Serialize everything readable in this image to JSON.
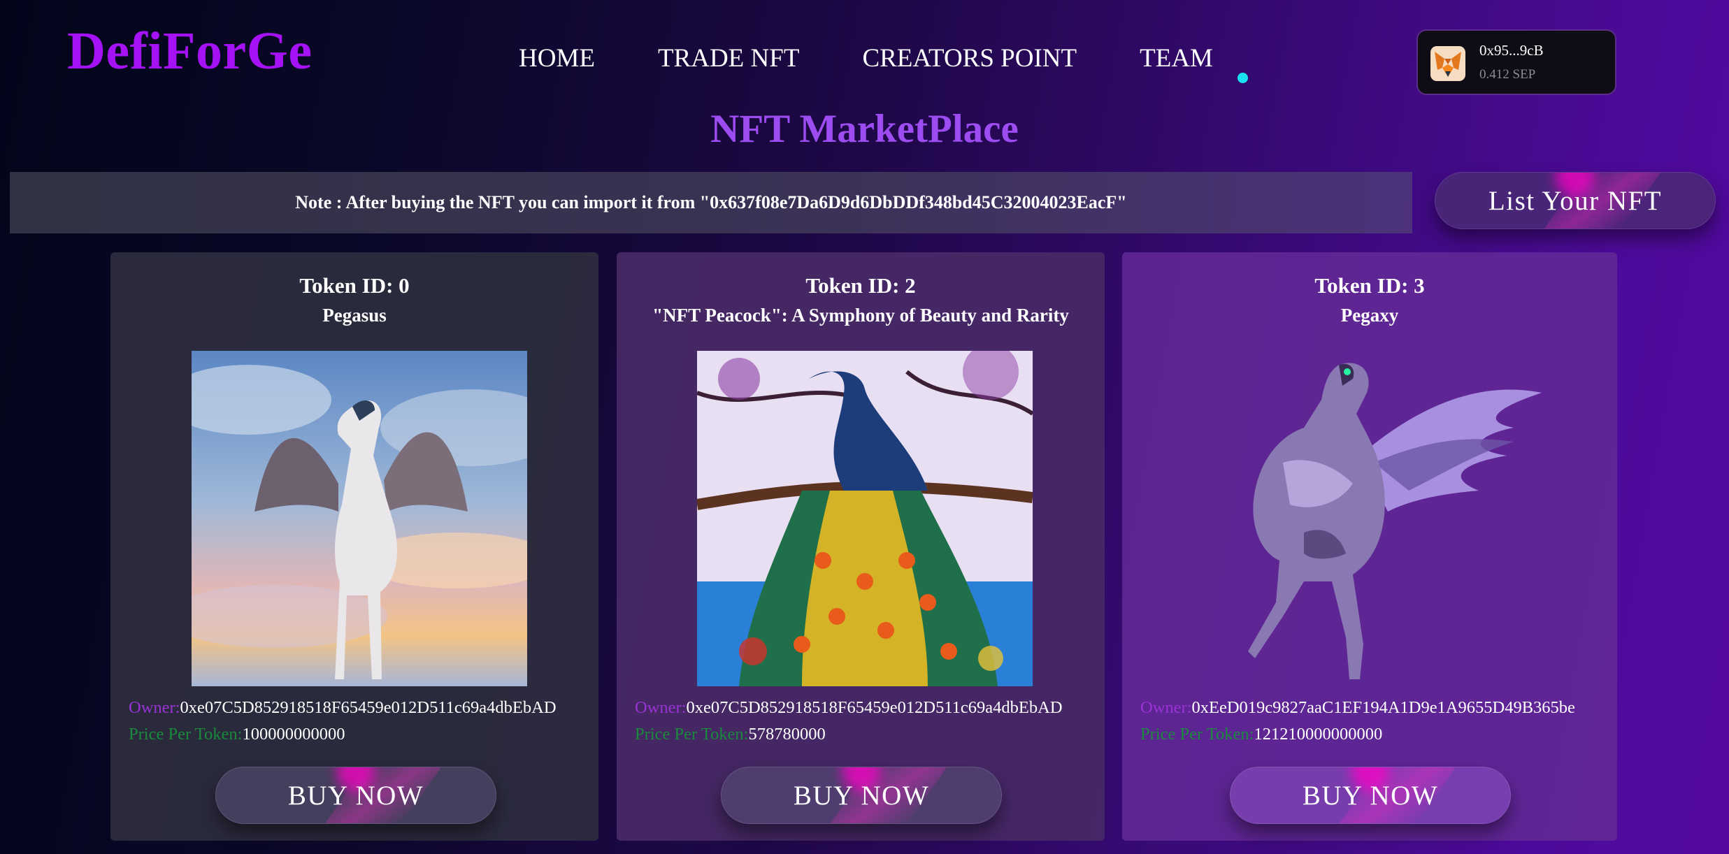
{
  "header": {
    "logo": "DefiForGe",
    "nav": [
      "HOME",
      "TRADE NFT",
      "CREATORS POINT",
      "TEAM"
    ]
  },
  "wallet": {
    "icon": "metamask-fox-icon",
    "address": "0x95...9cB",
    "balance": "0.412 SEP"
  },
  "page": {
    "title": "NFT MarketPlace",
    "note": "Note : After buying the NFT you can import it from \"0x637f08e7Da6D9d6DbDDf348bd45C32004023EacF\"",
    "list_button": "List Your NFT"
  },
  "cards": [
    {
      "token_id": "Token ID: 0",
      "name": "Pegasus",
      "image": "white-pegasus-clouds-image",
      "owner_label": "Owner:",
      "owner": "0xe07C5D852918518F65459e012D511c69a4dbEbAD",
      "price_label": "Price Per Token:",
      "price": "100000000000",
      "buy_label": "BUY NOW"
    },
    {
      "token_id": "Token ID: 2",
      "name": "\"NFT Peacock\": A Symphony of Beauty and Rarity",
      "image": "colorful-peacock-painting-image",
      "owner_label": "Owner:",
      "owner": "0xe07C5D852918518F65459e012D511c69a4dbEbAD",
      "price_label": "Price Per Token:",
      "price": "578780000",
      "buy_label": "BUY NOW"
    },
    {
      "token_id": "Token ID: 3",
      "name": "Pegaxy",
      "image": "robotic-pegasus-image",
      "owner_label": "Owner:",
      "owner": "0xEeD019c9827aaC1EF194A1D9e1A9655D49B365be",
      "price_label": "Price Per Token:",
      "price": "121210000000000",
      "buy_label": "BUY NOW"
    }
  ],
  "colors": {
    "logo": "#a412f5",
    "title": "#9d4cf2",
    "owner_label": "#9a32d6",
    "price_label": "#1a8a3c",
    "status_dot": "#19e3f0"
  }
}
